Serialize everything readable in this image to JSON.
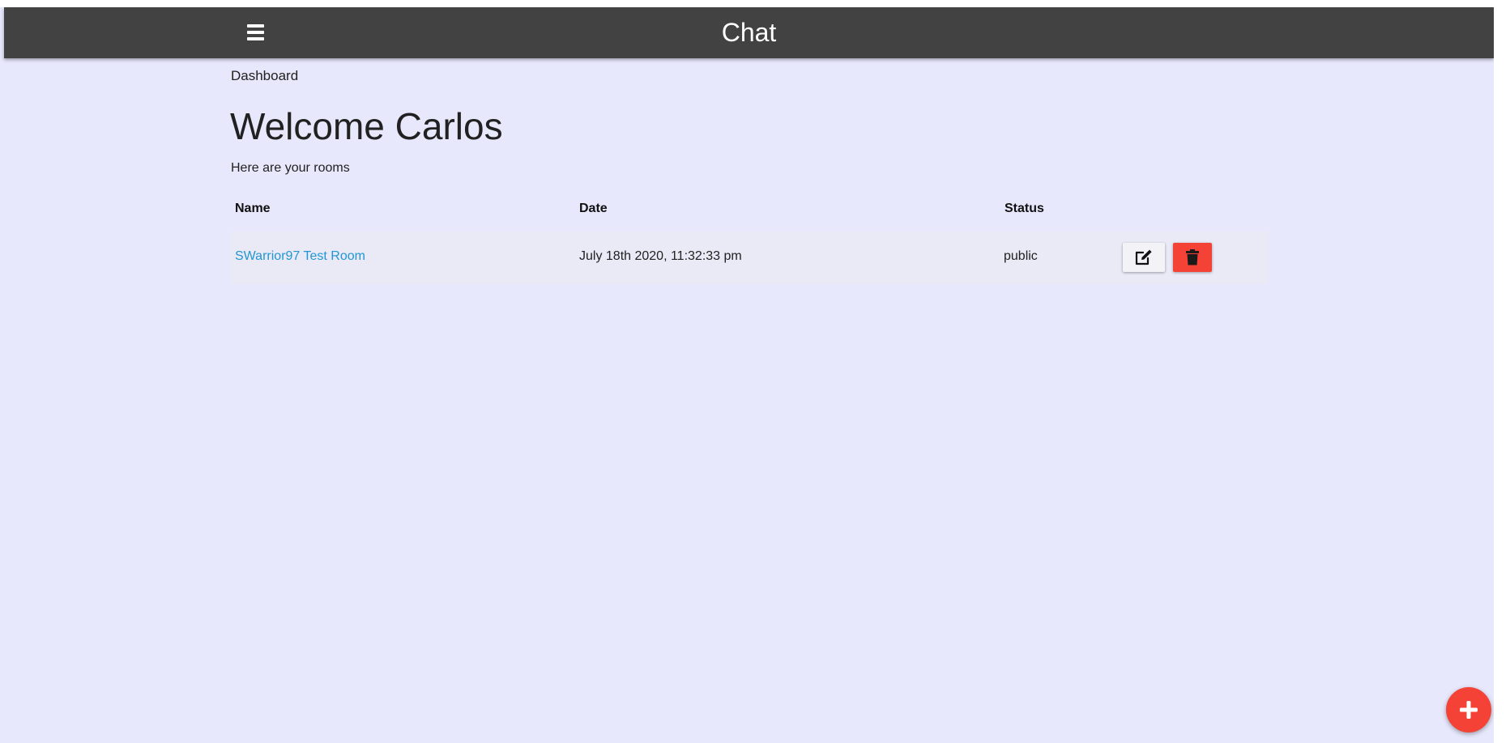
{
  "appbar": {
    "title": "Chat",
    "color": "#424242",
    "menu_icon": "hamburger-menu-icon"
  },
  "breadcrumb": "Dashboard",
  "welcome": {
    "title": "Welcome Carlos",
    "subtitle": "Here are your rooms"
  },
  "table": {
    "headers": [
      "Name",
      "Date",
      "Status"
    ],
    "rows": [
      {
        "name": "SWarrior97 Test Room",
        "date": "July 18th 2020, 11:32:33 pm",
        "status": "public",
        "actions": [
          "edit-icon",
          "delete-icon"
        ]
      }
    ]
  },
  "fab": {
    "icon": "plus-icon",
    "color": "#f44336"
  },
  "colors": {
    "background": "#e8e8fd",
    "link": "#2196d3",
    "danger": "#f44336"
  }
}
